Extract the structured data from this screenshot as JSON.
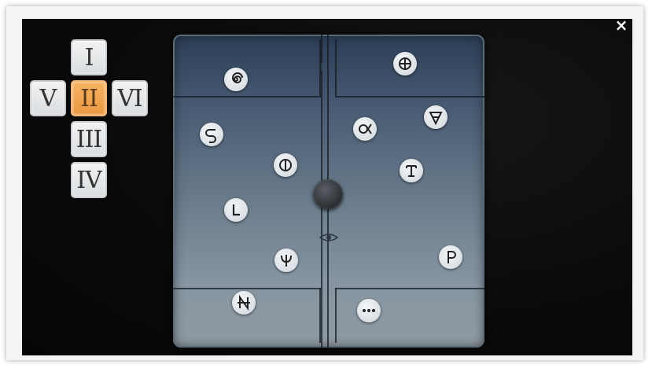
{
  "close_label": "×",
  "nav_tiles": {
    "up": "I",
    "center": "II",
    "left": "V",
    "right": "VI",
    "down": "III",
    "bottom": "IV"
  },
  "active_tile": "II",
  "colors": {
    "active_tile": "#e9973f",
    "tile": "#e4e7ea",
    "cabinet_top": "#2c3e56",
    "cabinet_bottom": "#8f9aa2"
  },
  "symbols": [
    "spiral-symbol",
    "circle-plus-symbol",
    "s-hook-symbol",
    "alpha-loop-symbol",
    "inverted-a-symbol",
    "circle-bar-symbol",
    "t-box-symbol",
    "l-symbol",
    "psi-symbol",
    "p-symbol",
    "crossed-n-symbol",
    "ellipsis-symbol"
  ]
}
